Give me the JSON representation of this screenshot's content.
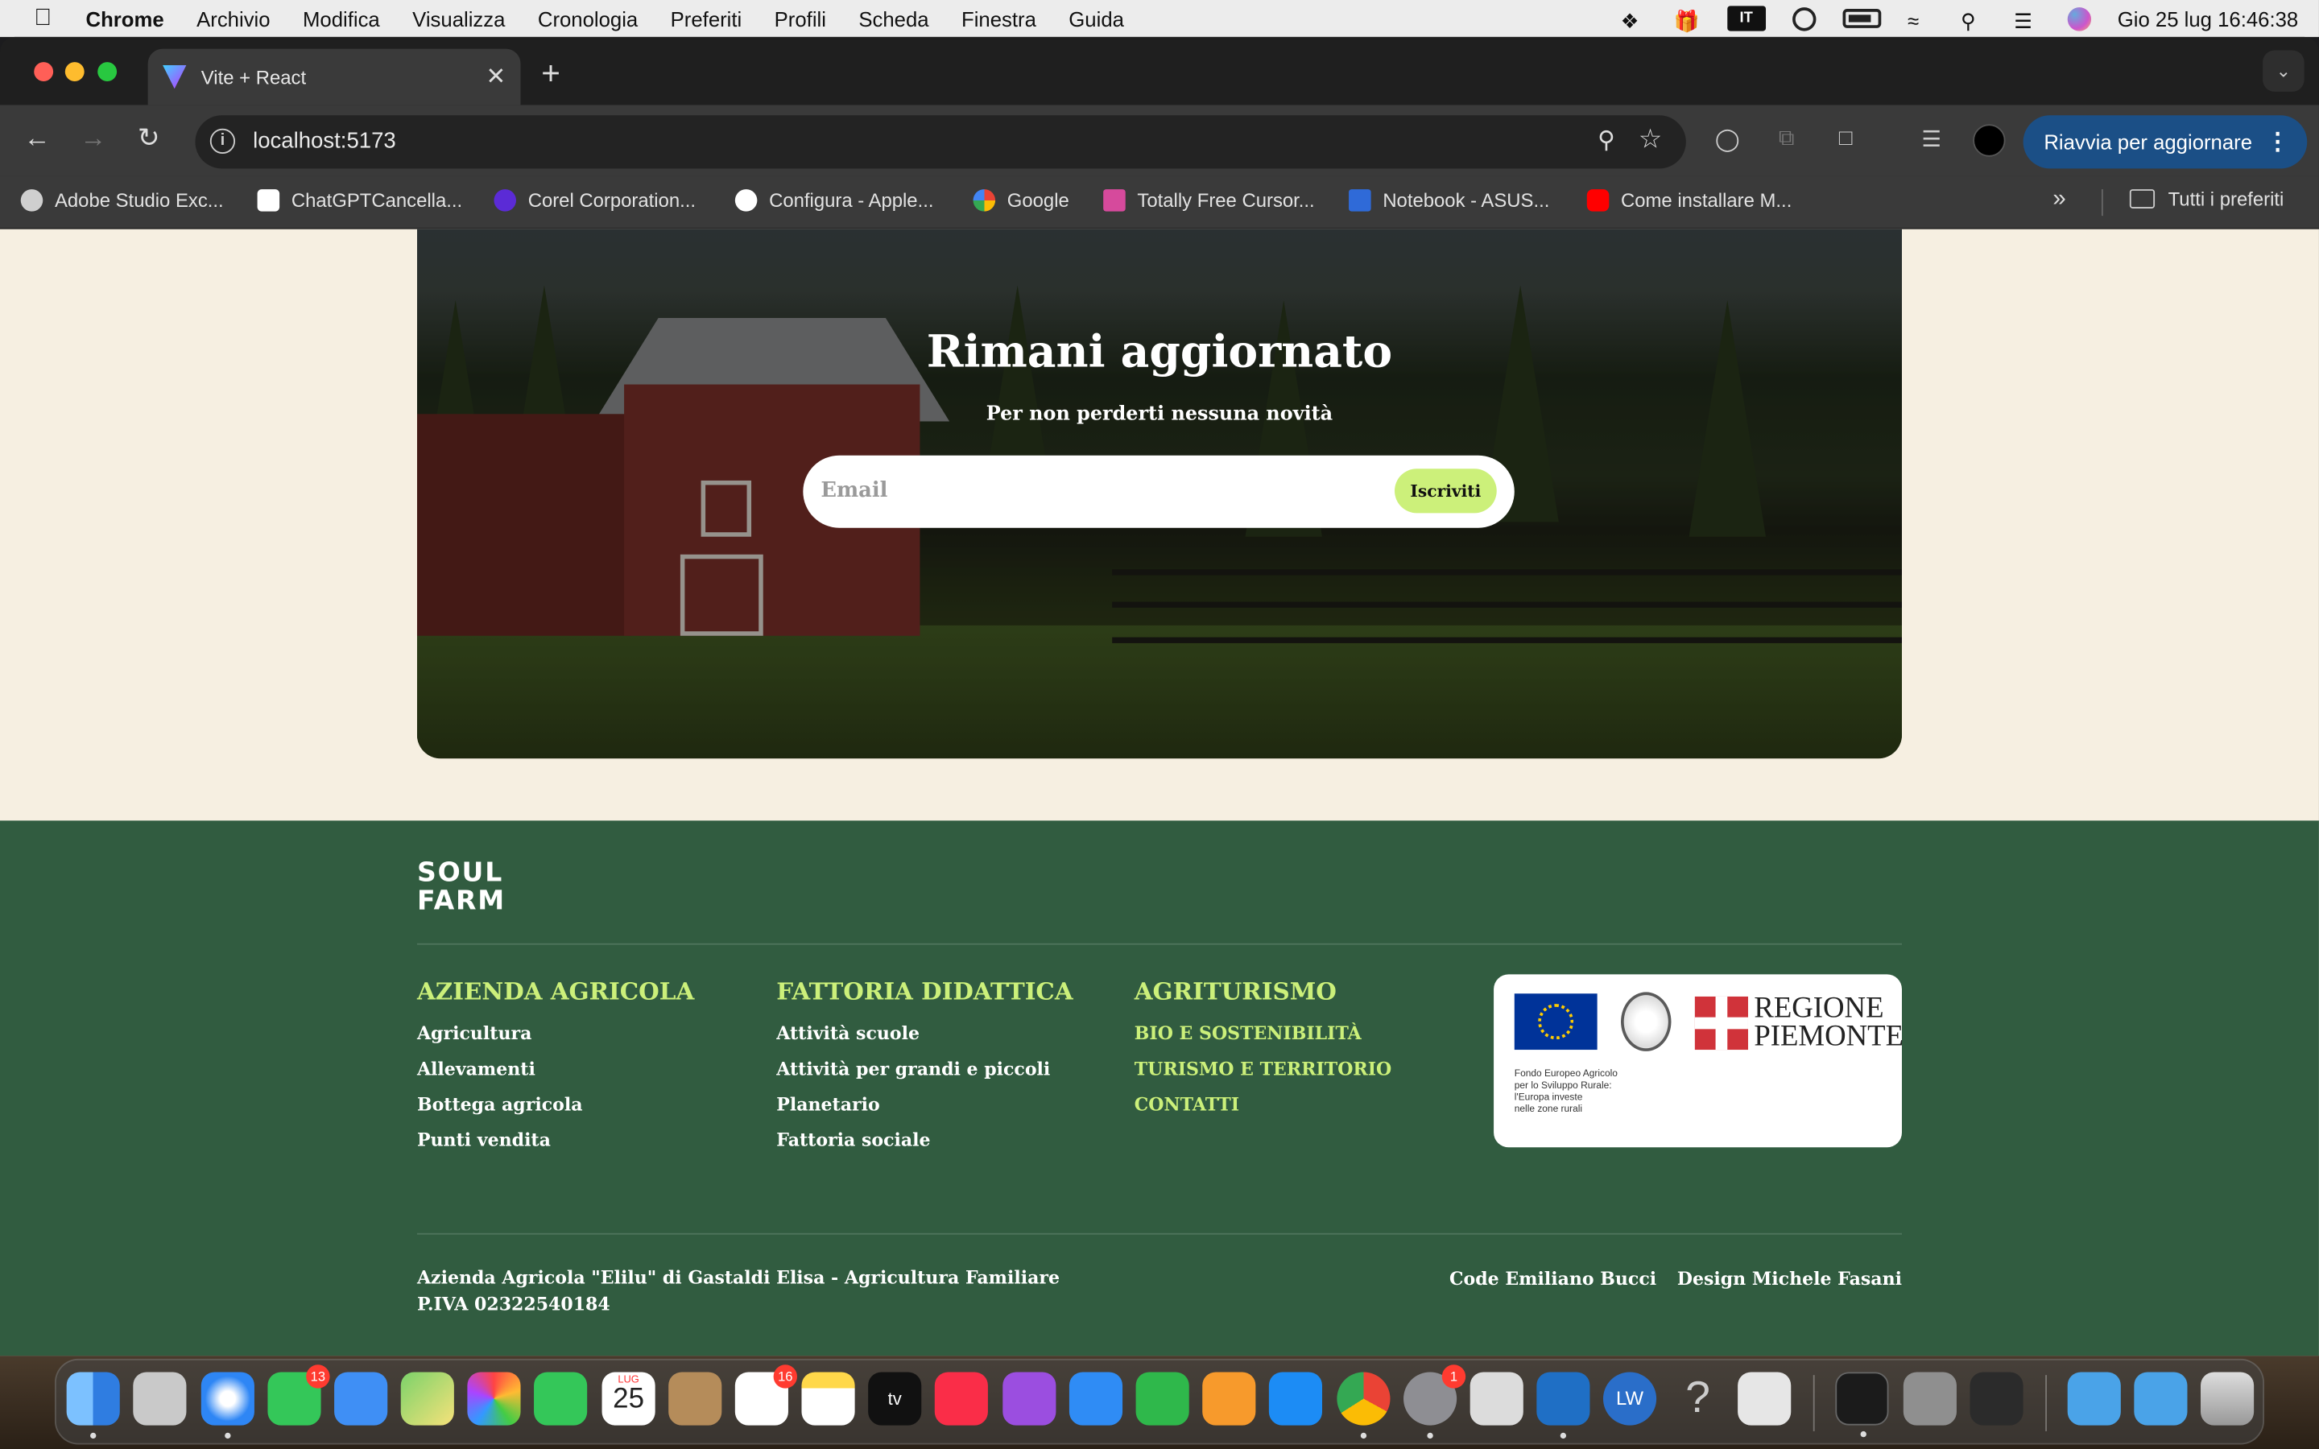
{
  "menubar": {
    "app": "Chrome",
    "items": [
      "Archivio",
      "Modifica",
      "Visualizza",
      "Cronologia",
      "Preferiti",
      "Profili",
      "Scheda",
      "Finestra",
      "Guida"
    ],
    "input_source": "IT",
    "datetime": "Gio 25 lug  16:46:38"
  },
  "browser": {
    "tab_title": "Vite + React",
    "url": "localhost:5173",
    "update_button": "Riavvia per aggiornare",
    "bookmarks": [
      {
        "label": "Adobe Studio Exc...",
        "color": "#cfcfcf"
      },
      {
        "label": "ChatGPTCancella...",
        "color": "#ffffff"
      },
      {
        "label": "Corel Corporation...",
        "color": "#5b2bd6"
      },
      {
        "label": "Configura - Apple...",
        "color": "#ffffff"
      },
      {
        "label": "Google",
        "color": "#4285f4"
      },
      {
        "label": "Totally Free Cursor...",
        "color": "#d64a9c"
      },
      {
        "label": "Notebook - ASUS...",
        "color": "#2f6ad8"
      },
      {
        "label": "Come installare M...",
        "color": "#ff0000"
      }
    ],
    "all_bookmarks": "Tutti i preferiti"
  },
  "hero": {
    "title": "Rimani aggiornato",
    "subtitle": "Per non perderti nessuna novità",
    "email_placeholder": "Email",
    "subscribe_label": "Iscriviti"
  },
  "footer": {
    "logo_line1": "SOUL",
    "logo_line2": "FARM",
    "columns": [
      {
        "heading": "AZIENDA AGRICOLA",
        "links": [
          "Agricultura",
          "Allevamenti",
          "Bottega agricola",
          "Punti vendita"
        ]
      },
      {
        "heading": "FATTORIA DIDATTICA",
        "links": [
          "Attività scuole",
          "Attività per grandi e piccoli",
          "Planetario",
          "Fattoria sociale"
        ]
      },
      {
        "heading": "AGRITURISMO",
        "links": [
          "BIO E SOSTENIBILITÀ",
          "TURISMO E TERRITORIO",
          "CONTATTI"
        ]
      }
    ],
    "eu_logo": {
      "regione_line1": "REGIONE",
      "regione_line2": "PIEMONTE",
      "text_line1": "Fondo Europeo Agricolo",
      "text_line2": "per lo Sviluppo Rurale:",
      "text_line3": "l'Europa investe",
      "text_line4": "nelle zone rurali"
    },
    "legal_line1": "Azienda Agricola \"Elilu\" di Gastaldi Elisa - Agricultura Familiare",
    "legal_line2": "P.IVA 02322540184",
    "credit_code": "Code Emiliano Bucci",
    "credit_design": "Design Michele Fasani"
  },
  "dock": {
    "messages_badge": "13",
    "calendar_month": "LUG",
    "calendar_day": "25",
    "reminders_badge": "16",
    "settings_badge": "1",
    "apps": [
      "finder",
      "launchpad",
      "safari",
      "messages",
      "mail",
      "maps",
      "photos",
      "facetime",
      "calendar",
      "contacts",
      "reminders",
      "notes",
      "tv",
      "music",
      "podcasts",
      "keynote",
      "numbers",
      "pages",
      "app-store",
      "chrome",
      "system-settings",
      "screenshot",
      "vscode",
      "lw",
      "help",
      "preview",
      "terminal",
      "font-book",
      "audio",
      "downloads",
      "applications",
      "trash"
    ]
  },
  "colors": {
    "accent": "#ccf07a",
    "footer_bg": "#315c40",
    "page_bg": "#f6efe1"
  }
}
